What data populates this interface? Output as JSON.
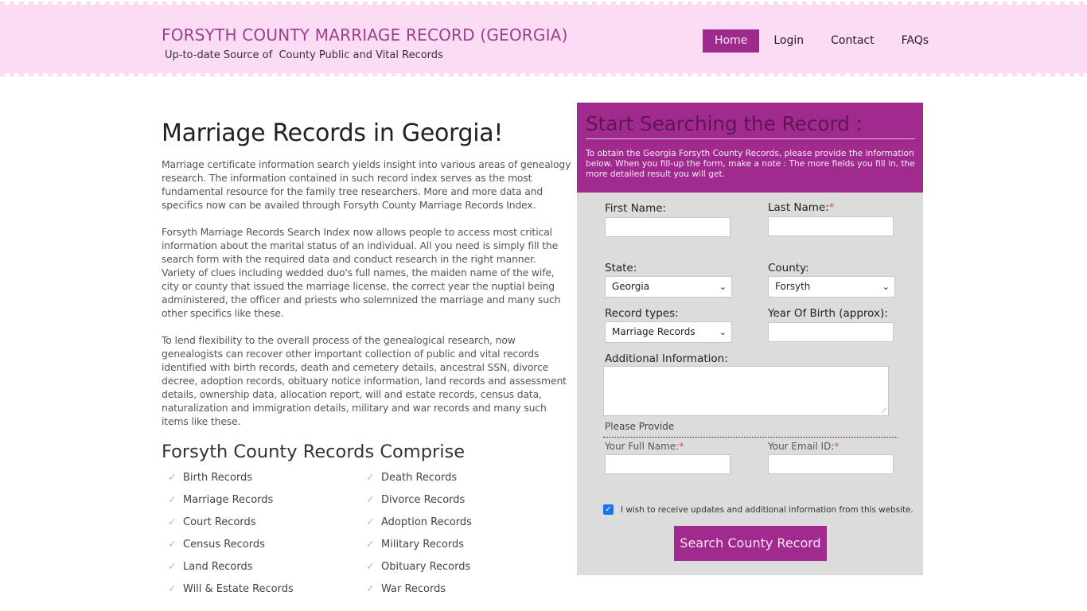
{
  "header": {
    "site_title": "FORSYTH COUNTY MARRIAGE RECORD (GEORGIA)",
    "tagline": "Up-to-date Source of  County Public and Vital Records",
    "nav": [
      {
        "label": "Home",
        "active": true
      },
      {
        "label": "Login",
        "active": false
      },
      {
        "label": "Contact",
        "active": false
      },
      {
        "label": "FAQs",
        "active": false
      }
    ]
  },
  "main": {
    "heading": "Marriage Records in Georgia!",
    "paragraphs": [
      "Marriage certificate information search yields insight into various areas of genealogy research. The information contained in such record index serves as the most fundamental resource for the family tree researchers. More and more data and specifics now can be availed through Forsyth County Marriage Records Index.",
      "Forsyth Marriage Records Search Index now allows people to access most critical information about the marital status of an individual. All you need is simply fill the search form with the required data and conduct research in the right manner. Variety of clues including wedded duo's full names, the maiden name of the wife, city or county that issued the marriage license, the correct year the nuptial being administered, the officer and priests who solemnized the marriage and many such other specifics like these.",
      "To lend flexibility to the overall process of the genealogical research, now genealogists can recover other important collection of public and vital records identified with birth records, death and cemetery details, ancestral SSN, divorce decree, adoption records, obituary notice information, land records and assessment details, ownership data, allocation report, will and estate records, census data, naturalization and immigration details, military and war records and many such items like these."
    ],
    "records_heading": "Forsyth County Records Comprise",
    "check_icon": "✓",
    "records": [
      "Birth Records",
      "Death Records",
      "Marriage Records",
      "Divorce Records",
      "Court Records",
      "Adoption Records",
      "Census Records",
      "Military Records",
      "Land Records",
      "Obituary Records",
      "Will & Estate Records",
      "War Records"
    ]
  },
  "form": {
    "title": "Start Searching the Record :",
    "intro": "To obtain the Georgia Forsyth County Records, please provide the information below. When you fill-up the form, make a note : The more fields you fill in, the more detailed result you will get.",
    "first_name_label": "First Name:",
    "first_name_value": "",
    "last_name_label": "Last Name:",
    "last_name_value": "",
    "required_mark": "*",
    "state_label": "State:",
    "state_value": "Georgia",
    "county_label": "County:",
    "county_value": "Forsyth",
    "record_types_label": "Record types:",
    "record_types_value": "Marriage Records",
    "yob_label": "Year Of Birth (approx):",
    "yob_value": "",
    "additional_label": "Additional Information:",
    "additional_value": "",
    "please_provide": "Please Provide",
    "full_name_label": "Your Full Name:",
    "full_name_value": "",
    "email_label": "Your Email ID:",
    "email_value": "",
    "optin_checked": true,
    "optin_label": "I wish to receive updates and additional information from this website.",
    "submit_label": "Search County Record",
    "chevron_icon": "❯"
  },
  "colors": {
    "accent": "#a12a8e",
    "header_bg": "#fcdbf4",
    "panel_bg": "#dcdcdc",
    "required": "#e04a6a"
  }
}
